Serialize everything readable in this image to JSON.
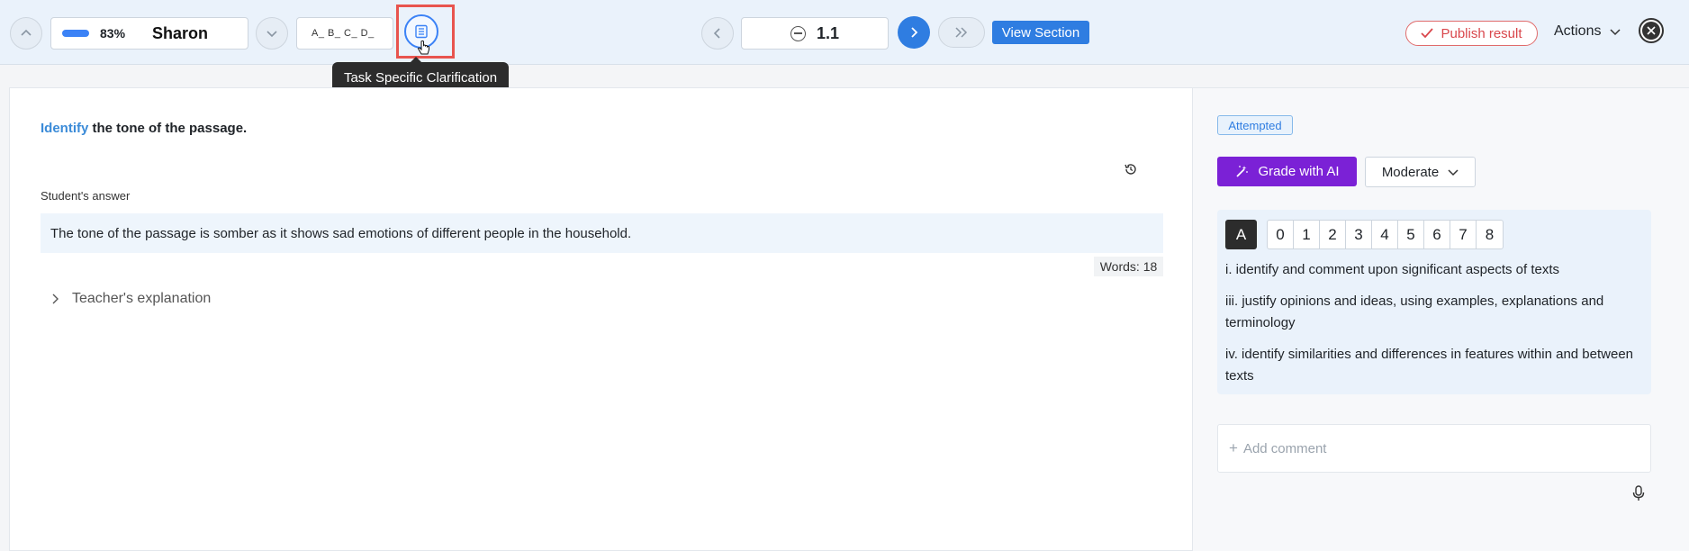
{
  "topbar": {
    "progress_pct": "83%",
    "student_name": "Sharon",
    "answer_choices": "A_ B_ C_ D_",
    "tooltip": "Task Specific Clarification",
    "question_number": "1.1",
    "view_section_label": "View Section",
    "publish_label": "Publish result",
    "actions_label": "Actions"
  },
  "question": {
    "keyword": "Identify",
    "rest": " the tone of the passage."
  },
  "answer": {
    "label": "Student's answer",
    "text": "The tone of the passage is somber as it shows sad emotions of different people in the household.",
    "word_count": "Words: 18"
  },
  "teacher_explanation_label": "Teacher's explanation",
  "side": {
    "status_badge": "Attempted",
    "grade_ai_label": "Grade with AI",
    "moderate_label": "Moderate",
    "criterion_label": "A",
    "scores": [
      "0",
      "1",
      "2",
      "3",
      "4",
      "5",
      "6",
      "7",
      "8"
    ],
    "strands": [
      "i. identify and comment upon significant aspects of texts",
      "iii. justify opinions and ideas, using examples, explanations and terminology",
      "iv. identify similarities and differences in features within and between texts"
    ],
    "comment_placeholder": "Add comment"
  },
  "colors": {
    "accent": "#2f7de1",
    "ai_purple": "#7b21d6",
    "publish_red": "#d9474c",
    "highlight_red": "#e8544e"
  }
}
